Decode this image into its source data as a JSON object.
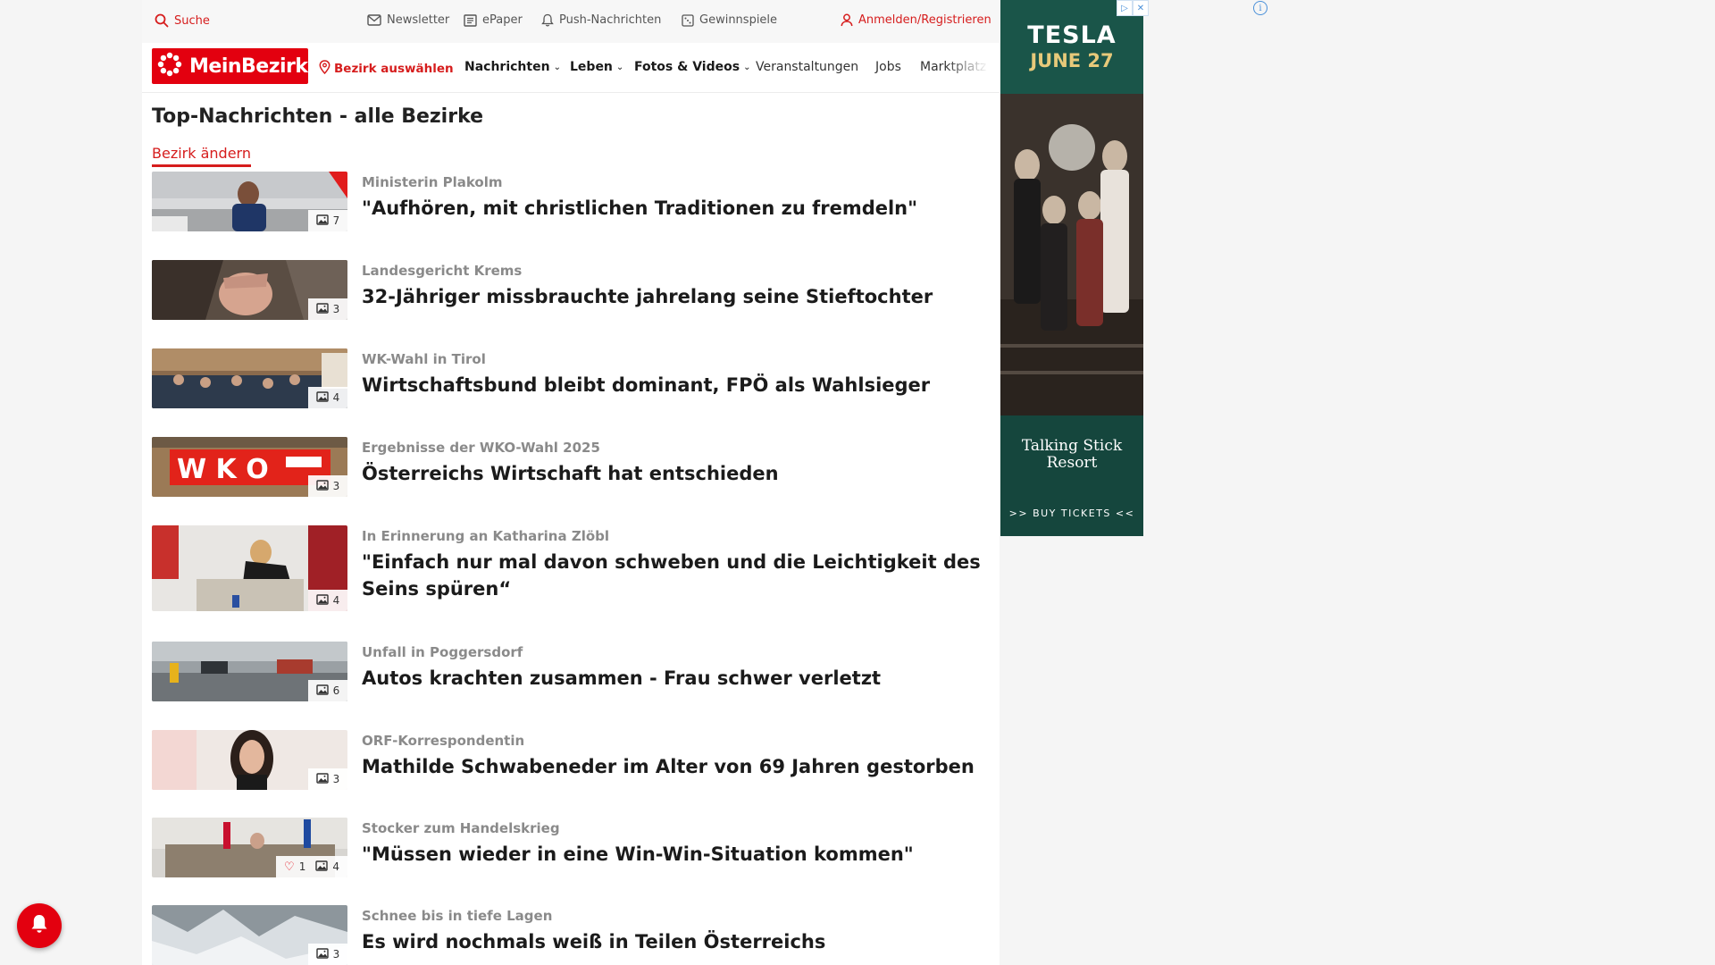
{
  "topbar": {
    "search": "Suche",
    "newsletter": "Newsletter",
    "epaper": "ePaper",
    "push": "Push-Nachrichten",
    "gewinnspiele": "Gewinnspiele",
    "login": "Anmelden/Registrieren"
  },
  "nav": {
    "logo": "MeinBezirk",
    "bezirk": "Bezirk auswählen",
    "nachrichten": "Nachrichten",
    "leben": "Leben",
    "fotos": "Fotos & Videos",
    "veranstaltungen": "Veranstaltungen",
    "jobs": "Jobs",
    "marktplatz": "Marktplatz"
  },
  "page": {
    "title": "Top-Nachrichten - alle Bezirke",
    "change": "Bezirk ändern"
  },
  "articles": [
    {
      "kicker": "Ministerin Plakolm",
      "title": "\"Aufhören, mit christlichen Traditionen zu fremdeln\"",
      "photos": "7",
      "likes": null
    },
    {
      "kicker": "Landesgericht Krems",
      "title": "32-Jähriger missbrauchte jahrelang seine Stieftochter",
      "photos": "3",
      "likes": null
    },
    {
      "kicker": "WK-Wahl in Tirol",
      "title": "Wirtschaftsbund bleibt dominant, FPÖ als Wahlsieger",
      "photos": "4",
      "likes": null
    },
    {
      "kicker": "Ergebnisse der WKO-Wahl 2025",
      "title": "Österreichs Wirtschaft hat entschieden",
      "photos": "3",
      "likes": null
    },
    {
      "kicker": "In Erinnerung an Katharina Zlöbl",
      "title": "\"Einfach nur mal davon schweben und die Leichtigkeit des Seins spüren“",
      "photos": "4",
      "likes": null
    },
    {
      "kicker": "Unfall in Poggersdorf",
      "title": "Autos krachten zusammen - Frau schwer verletzt",
      "photos": "6",
      "likes": null
    },
    {
      "kicker": "ORF-Korrespondentin",
      "title": "Mathilde Schwabeneder im Alter von 69 Jahren gestorben",
      "photos": "3",
      "likes": null
    },
    {
      "kicker": "Stocker zum Handelskrieg",
      "title": "\"Müssen wieder in eine Win-Win-Situation kommen\"",
      "photos": "4",
      "likes": "1"
    },
    {
      "kicker": "Schnee bis in tiefe Lagen",
      "title": "Es wird nochmals weiß in Teilen Österreichs",
      "photos": "3",
      "likes": null
    }
  ],
  "ad": {
    "title": "TESLA",
    "date": "JUNE 27",
    "resort": "Talking Stick Resort",
    "cta": ">> BUY TICKETS <<"
  },
  "colors": {
    "brand": "#e3000f",
    "accent_text": "#d61d1d",
    "kicker": "#8a8a8a",
    "ad_bg": "#15463d"
  },
  "icons": {
    "search": "search-icon",
    "newsletter": "mail-icon",
    "epaper": "newspaper-icon",
    "push": "bell-icon",
    "gewinnspiele": "gift-icon",
    "login": "user-icon",
    "bezirk": "map-pin-icon",
    "photos": "image-icon",
    "likes": "heart-icon"
  }
}
